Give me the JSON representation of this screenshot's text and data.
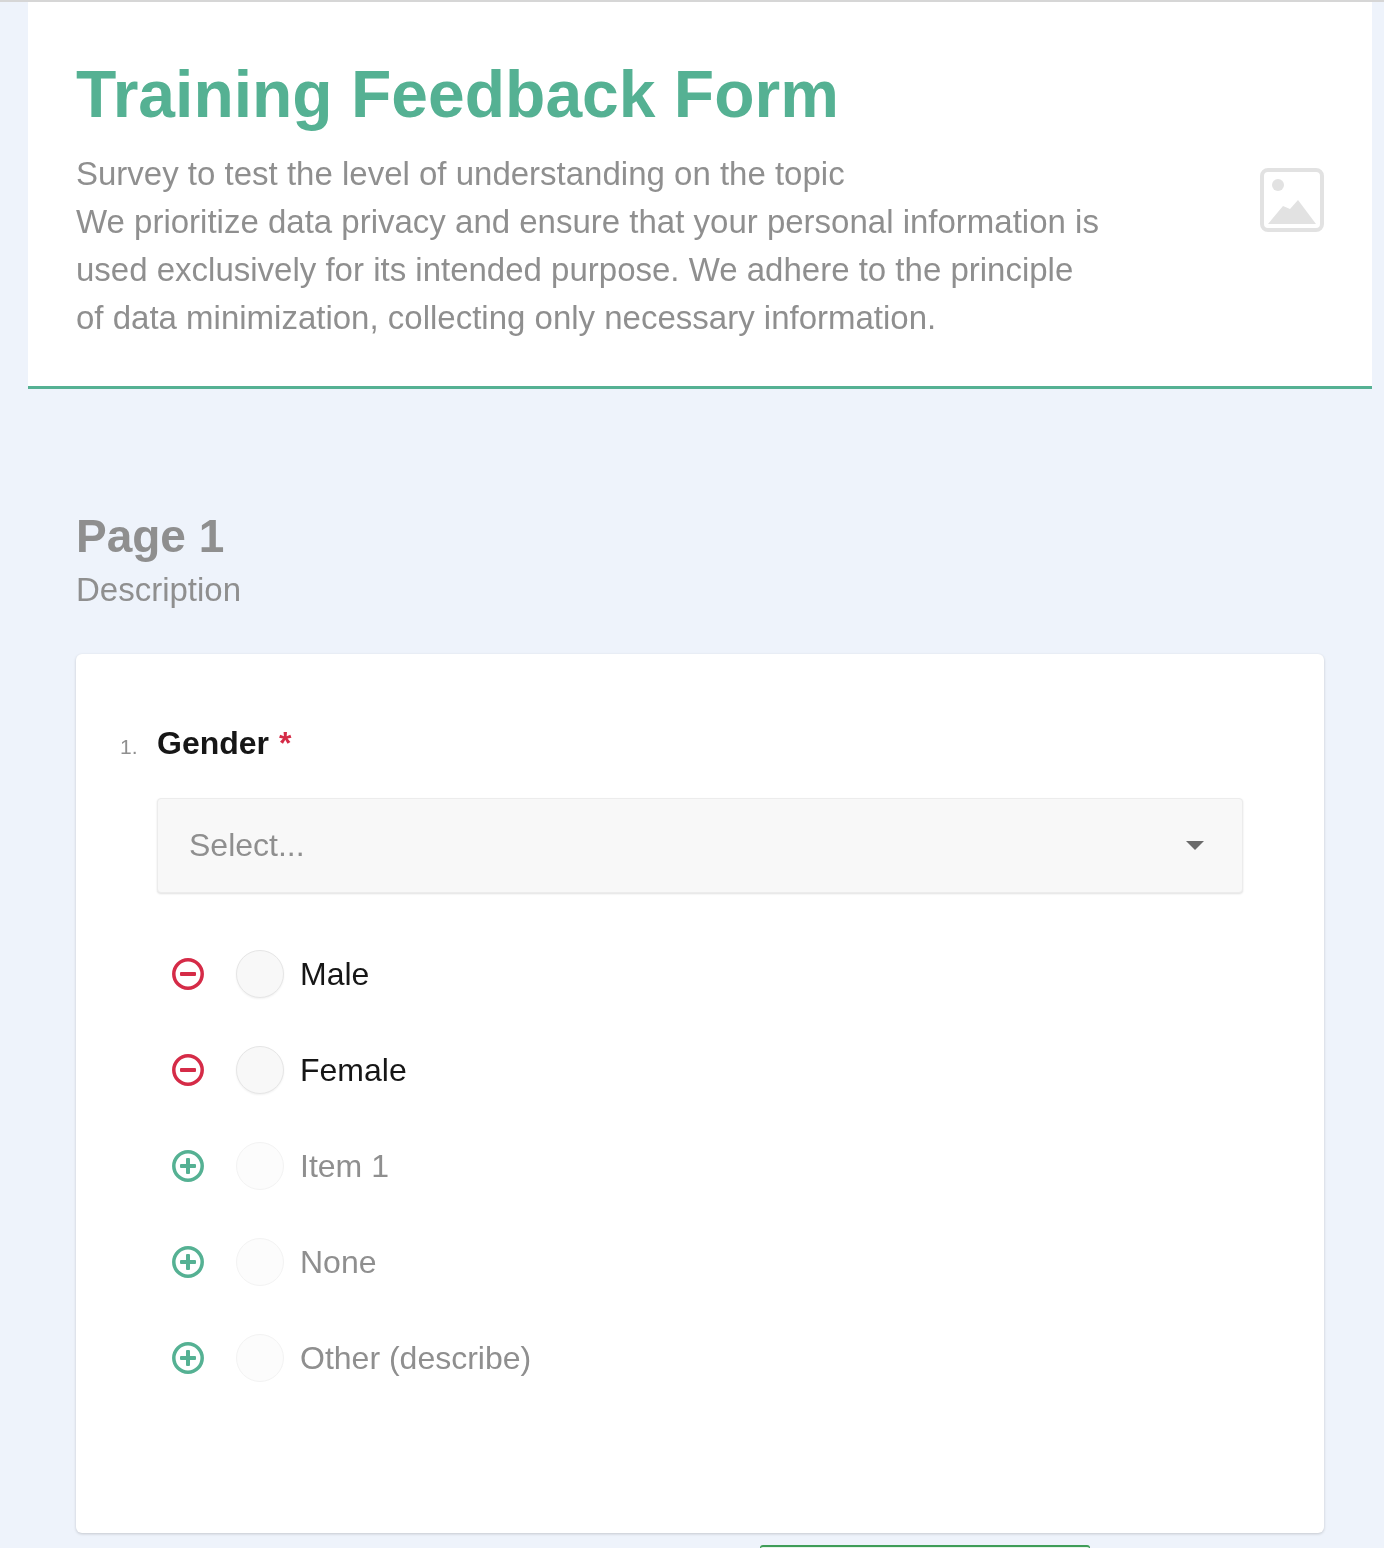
{
  "header": {
    "title": "Training Feedback Form",
    "description": "Survey to test the level of understanding on the topic\nWe prioritize data privacy and ensure that your personal information is\nused exclusively for its intended purpose. We adhere to the principle\nof data minimization, collecting only necessary information."
  },
  "page": {
    "title": "Page 1",
    "description": "Description"
  },
  "questions": [
    {
      "number": "1.",
      "title": "Gender",
      "required_mark": "*",
      "select": {
        "placeholder": "Select..."
      },
      "options": [
        {
          "kind": "existing",
          "label": "Male",
          "selected": false
        },
        {
          "kind": "existing",
          "label": "Female",
          "selected": false
        },
        {
          "kind": "suggested",
          "label": "Item 1",
          "selected": false
        },
        {
          "kind": "suggested",
          "label": "None",
          "selected": false
        },
        {
          "kind": "suggested",
          "label": "Other (describe)",
          "selected": false
        }
      ]
    }
  ]
}
